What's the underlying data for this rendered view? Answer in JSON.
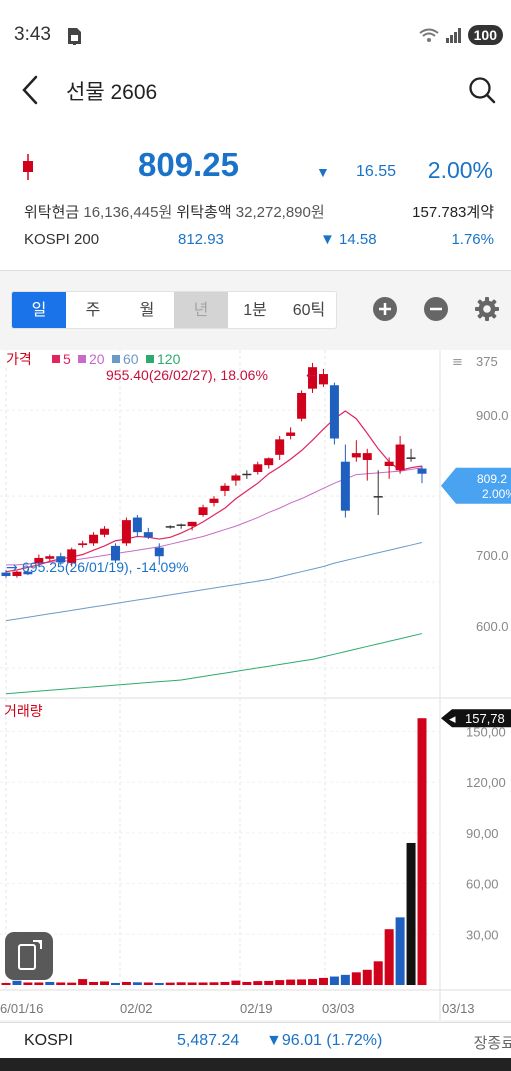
{
  "status": {
    "time": "3:43",
    "battery": "100"
  },
  "header": {
    "title": "선물 2606"
  },
  "quote": {
    "price": "809.25",
    "direction_arrow": "▼",
    "change": "16.55",
    "change_pct": "2.00%",
    "colors": {
      "down": "#1a73c8",
      "up": "#d0021b"
    }
  },
  "info": {
    "deposit_label": "위탁현금",
    "deposit_value": "16,136,445원",
    "total_label": "위탁총액",
    "total_value": "32,272,890원",
    "contracts": "157.783계약",
    "kospi200_label": "KOSPI 200",
    "kospi200_value": "812.93",
    "kospi200_arrow": "▼",
    "kospi200_change": "14.58",
    "kospi200_pct": "1.76%"
  },
  "period_tabs": [
    {
      "label": "일",
      "state": "active"
    },
    {
      "label": "주",
      "state": "normal"
    },
    {
      "label": "월",
      "state": "normal"
    },
    {
      "label": "년",
      "state": "disabled"
    },
    {
      "label": "1분",
      "state": "normal"
    },
    {
      "label": "60틱",
      "state": "normal"
    }
  ],
  "toolbar": {
    "icons": [
      "zoom-in-icon",
      "zoom-out-icon",
      "settings-icon"
    ]
  },
  "chart_data": {
    "type": "candlestick",
    "price_legend": {
      "label": "가격",
      "ma": [
        {
          "name": "5",
          "color": "#e0245e"
        },
        {
          "name": "20",
          "color": "#c86ac8"
        },
        {
          "name": "60",
          "color": "#6a9ac8"
        },
        {
          "name": "120",
          "color": "#2eaa6e"
        }
      ]
    },
    "price_axis_ticks": [
      900,
      800,
      700,
      600
    ],
    "price_axis_labels": [
      "375",
      "900.0",
      "700.0",
      "600.0"
    ],
    "current_price_tag": [
      "809.2",
      "2.00%"
    ],
    "high_annotation": "955.40(26/02/27), 18.06%",
    "low_annotation": "695.25(26/01/19), -14.09%",
    "volume_label": "거래량",
    "volume_axis_labels": [
      "150,00",
      "120,00",
      "90,00",
      "60,00",
      "30,00"
    ],
    "volume_tag": "157,78",
    "x_labels": [
      "6/01/16",
      "02/02",
      "02/19",
      "03/03",
      "03/13"
    ],
    "candles": [
      {
        "o": 711,
        "h": 714,
        "l": 705,
        "c": 707
      },
      {
        "o": 707,
        "h": 713,
        "l": 705,
        "c": 712
      },
      {
        "o": 712,
        "h": 715,
        "l": 708,
        "c": 709
      },
      {
        "o": 722,
        "h": 732,
        "l": 718,
        "c": 728
      },
      {
        "o": 727,
        "h": 732,
        "l": 724,
        "c": 730
      },
      {
        "o": 730,
        "h": 734,
        "l": 720,
        "c": 723
      },
      {
        "o": 722,
        "h": 740,
        "l": 718,
        "c": 738
      },
      {
        "o": 743,
        "h": 748,
        "l": 740,
        "c": 745
      },
      {
        "o": 745,
        "h": 758,
        "l": 742,
        "c": 755
      },
      {
        "o": 755,
        "h": 765,
        "l": 752,
        "c": 762
      },
      {
        "o": 742,
        "h": 745,
        "l": 722,
        "c": 725
      },
      {
        "o": 745,
        "h": 775,
        "l": 742,
        "c": 772
      },
      {
        "o": 775,
        "h": 778,
        "l": 752,
        "c": 758
      },
      {
        "o": 758,
        "h": 763,
        "l": 750,
        "c": 752
      },
      {
        "o": 740,
        "h": 745,
        "l": 720,
        "c": 730
      },
      {
        "o": 765,
        "h": 766,
        "l": 762,
        "c": 765
      },
      {
        "o": 767,
        "h": 768,
        "l": 762,
        "c": 767
      },
      {
        "o": 765,
        "h": 770,
        "l": 760,
        "c": 770
      },
      {
        "o": 778,
        "h": 790,
        "l": 776,
        "c": 787
      },
      {
        "o": 792,
        "h": 800,
        "l": 788,
        "c": 797
      },
      {
        "o": 806,
        "h": 815,
        "l": 800,
        "c": 812
      },
      {
        "o": 818,
        "h": 826,
        "l": 812,
        "c": 824
      },
      {
        "o": 826,
        "h": 830,
        "l": 820,
        "c": 826
      },
      {
        "o": 828,
        "h": 840,
        "l": 825,
        "c": 837
      },
      {
        "o": 836,
        "h": 845,
        "l": 832,
        "c": 844
      },
      {
        "o": 848,
        "h": 870,
        "l": 842,
        "c": 866
      },
      {
        "o": 870,
        "h": 880,
        "l": 866,
        "c": 874
      },
      {
        "o": 890,
        "h": 923,
        "l": 887,
        "c": 920
      },
      {
        "o": 925,
        "h": 955,
        "l": 920,
        "c": 950
      },
      {
        "o": 930,
        "h": 948,
        "l": 927,
        "c": 942
      },
      {
        "o": 929,
        "h": 932,
        "l": 860,
        "c": 867
      },
      {
        "o": 840,
        "h": 860,
        "l": 775,
        "c": 783
      },
      {
        "o": 845,
        "h": 865,
        "l": 840,
        "c": 850
      },
      {
        "o": 842,
        "h": 855,
        "l": 818,
        "c": 850
      },
      {
        "o": 800,
        "h": 830,
        "l": 778,
        "c": 800
      },
      {
        "o": 835,
        "h": 845,
        "l": 820,
        "c": 840
      },
      {
        "o": 830,
        "h": 870,
        "l": 826,
        "c": 860
      },
      {
        "o": 845,
        "h": 855,
        "l": 840,
        "c": 845
      },
      {
        "o": 832,
        "h": 835,
        "l": 815,
        "c": 826
      }
    ],
    "ma5": [
      712,
      714,
      717,
      720,
      724,
      727,
      729,
      732,
      737,
      742,
      748,
      750,
      753,
      752,
      750,
      752,
      757,
      763,
      770,
      778,
      786,
      797,
      806,
      815,
      826,
      834,
      843,
      853,
      865,
      878,
      890,
      899,
      890,
      873,
      855,
      840,
      830,
      833,
      835
    ],
    "ma20": [
      720,
      720,
      721,
      722,
      723,
      724,
      725,
      727,
      729,
      731,
      733,
      735,
      737,
      739,
      741,
      744,
      747,
      750,
      753,
      757,
      761,
      765,
      770,
      775,
      781,
      786,
      792,
      797,
      803,
      809,
      815,
      820,
      825,
      826,
      827,
      828,
      829,
      831,
      833
    ],
    "ma60": [
      655,
      657,
      659,
      661,
      663,
      665,
      667,
      669,
      671,
      673,
      675,
      677,
      679,
      681,
      683,
      685,
      687,
      689,
      691,
      693,
      695,
      697,
      699,
      701,
      703,
      706,
      709,
      712,
      715,
      718,
      722,
      725,
      728,
      731,
      734,
      737,
      740,
      743,
      746
    ],
    "ma120": [
      570,
      571,
      572,
      573,
      574,
      575,
      576,
      577,
      578,
      579,
      580,
      581,
      582,
      583,
      584,
      585,
      586,
      588,
      590,
      592,
      594,
      596,
      598,
      600,
      602,
      604,
      606,
      608,
      610,
      613,
      616,
      619,
      622,
      625,
      628,
      631,
      634,
      637,
      640
    ],
    "volume": [
      1200,
      2500,
      1500,
      1500,
      1800,
      1500,
      1400,
      3500,
      1800,
      2100,
      1200,
      1800,
      1600,
      1500,
      1200,
      1400,
      1600,
      1500,
      1500,
      1600,
      1800,
      2600,
      1800,
      2300,
      2400,
      2900,
      3200,
      3300,
      3500,
      4200,
      5000,
      6000,
      7500,
      9000,
      14000,
      33000,
      40000,
      84000,
      157783
    ],
    "volume_up": [
      true,
      false,
      true,
      true,
      false,
      true,
      true,
      true,
      true,
      true,
      false,
      true,
      false,
      true,
      false,
      true,
      true,
      true,
      true,
      true,
      true,
      true,
      true,
      true,
      true,
      true,
      true,
      true,
      true,
      true,
      false,
      false,
      true,
      true,
      true,
      true,
      false,
      false,
      true
    ]
  },
  "bottom_ticker": {
    "name": "KOSPI",
    "value": "5,487.24",
    "change": "▼96.01 (1.72%)",
    "status": "장종료"
  }
}
